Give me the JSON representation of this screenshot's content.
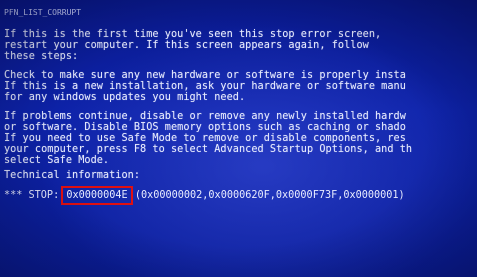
{
  "error_name": "PFN_LIST_CORRUPT",
  "paragraph1": [
    "If this is the first time you've seen this stop error screen,",
    "restart your computer. If this screen appears again, follow",
    "these steps:"
  ],
  "paragraph2": [
    "Check to make sure any new hardware or software is properly insta",
    "If this is a new installation, ask your hardware or software manu",
    "for any windows updates you might need."
  ],
  "paragraph3": [
    "If problems continue, disable or remove any newly installed hardw",
    "or software. Disable BIOS memory options such as caching or shado",
    "If you need to use Safe Mode to remove or disable components, res",
    "your computer, press F8 to select Advanced Startup Options, and th",
    "select Safe Mode."
  ],
  "technical_label": "Technical information:",
  "stop": {
    "prefix": "*** STOP: ",
    "code": "0x0000004E",
    "params": " (0x00000002,0x0000620F,0x0000F73F,0x0000001)"
  }
}
